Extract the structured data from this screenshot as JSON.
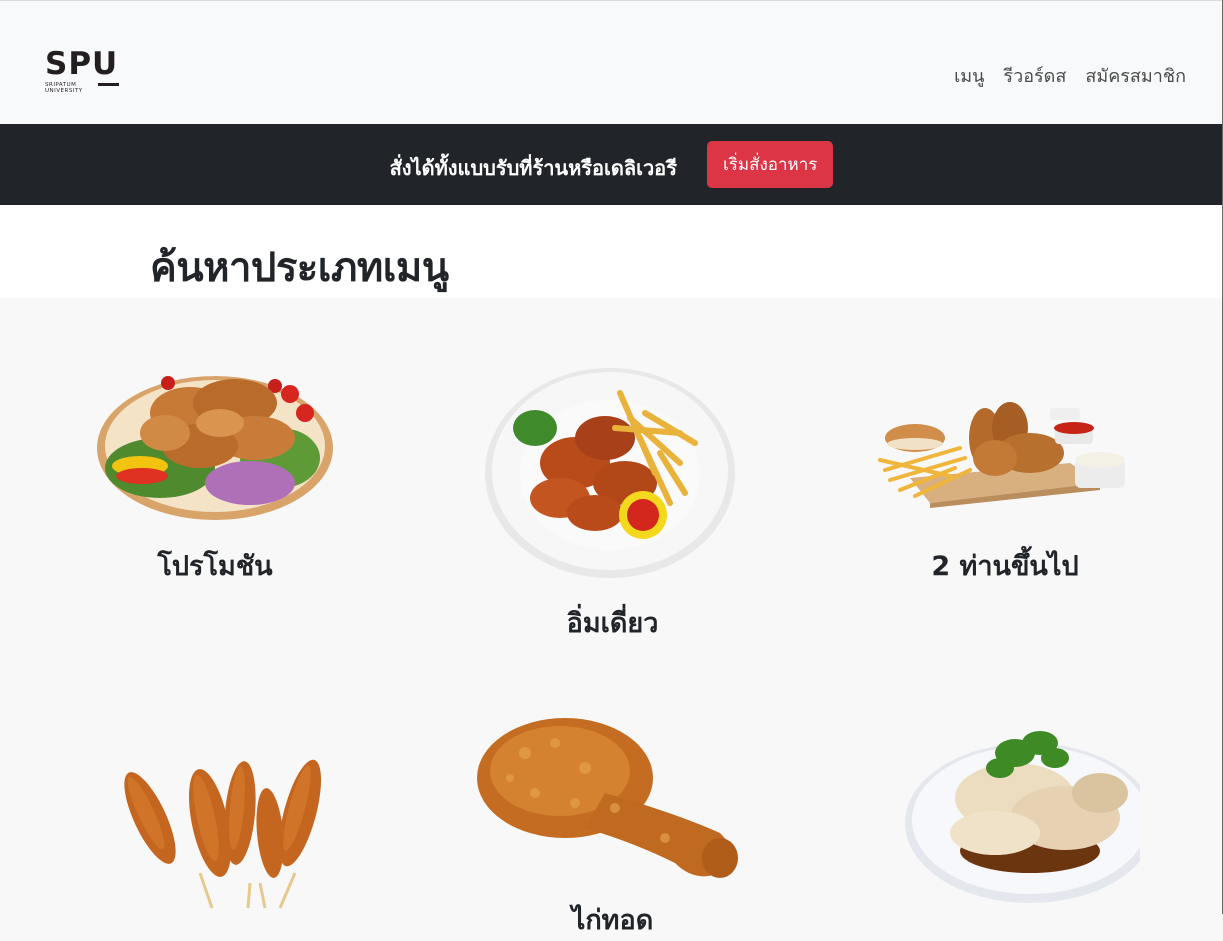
{
  "navbar": {
    "logo": {
      "main": "SPU",
      "sub_line1": "SRIPATUM",
      "sub_line2": "UNIVERSITY"
    },
    "links": [
      {
        "label": "เมนู"
      },
      {
        "label": "รีวอร์ดส"
      },
      {
        "label": "สมัครสมาชิก"
      }
    ]
  },
  "promo": {
    "text": "สั่งได้ทั้งแบบรับที่ร้านหรือเดลิเวอรี",
    "button_label": "เริ่มสั่งอาหาร",
    "button_color": "#dc3545"
  },
  "page": {
    "title": "ค้นหาประเภทเมนู"
  },
  "categories": [
    {
      "label": "โปรโมชัน",
      "image": "fried-chicken-platter-image"
    },
    {
      "label": "อิ่มเดี่ยว",
      "image": "wings-and-fries-plate-image"
    },
    {
      "label": "2 ท่านขึ้นไป",
      "image": "chicken-fries-tray-image"
    },
    {
      "label": "",
      "image": "fried-sticks-image"
    },
    {
      "label": "ไก่ทอด",
      "image": "fried-drumstick-image"
    },
    {
      "label": "",
      "image": "hainanese-chicken-image"
    }
  ]
}
